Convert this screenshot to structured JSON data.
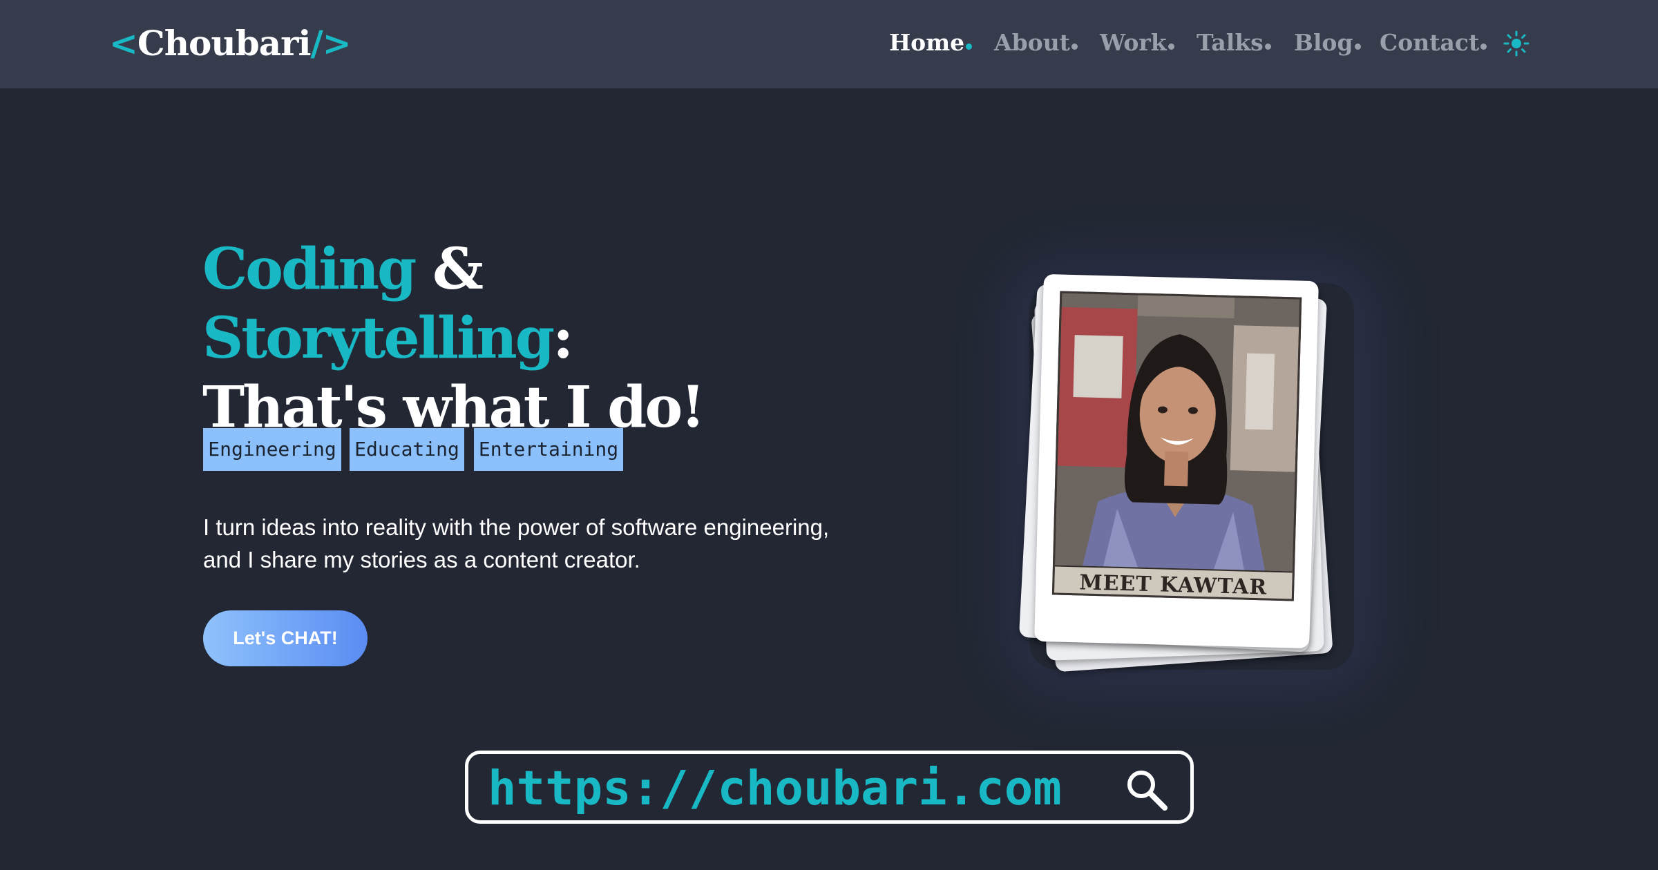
{
  "logo": {
    "open": "<",
    "name": "Choubari",
    "close": "/>"
  },
  "nav": {
    "items": [
      {
        "label": "Home"
      },
      {
        "label": "About"
      },
      {
        "label": "Work"
      },
      {
        "label": "Talks"
      },
      {
        "label": "Blog"
      },
      {
        "label": "Contact"
      }
    ],
    "active": "Home",
    "theme_toggle_icon": "sun-icon"
  },
  "hero": {
    "headline": {
      "part1": "Coding",
      "amp": " & ",
      "part2": "Storytelling",
      "colon": ":",
      "line2": "That's what I do!"
    },
    "tags": [
      "Engineering",
      "Educating",
      "Entertaining"
    ],
    "intro": "I turn ideas into reality with the power of software engineering, and I share my stories as a content creator.",
    "cta_label": "Let's CHAT!"
  },
  "photo": {
    "caption": "MEET KAWTAR"
  },
  "url_bar": {
    "text": "https://choubari.com",
    "icon": "search-icon"
  },
  "colors": {
    "background": "#222733",
    "header": "#363c4b",
    "accent": "#18b9c4",
    "tag": "#8cc0fb",
    "button_start": "#8fc2fb",
    "button_end": "#5a8cf3"
  }
}
